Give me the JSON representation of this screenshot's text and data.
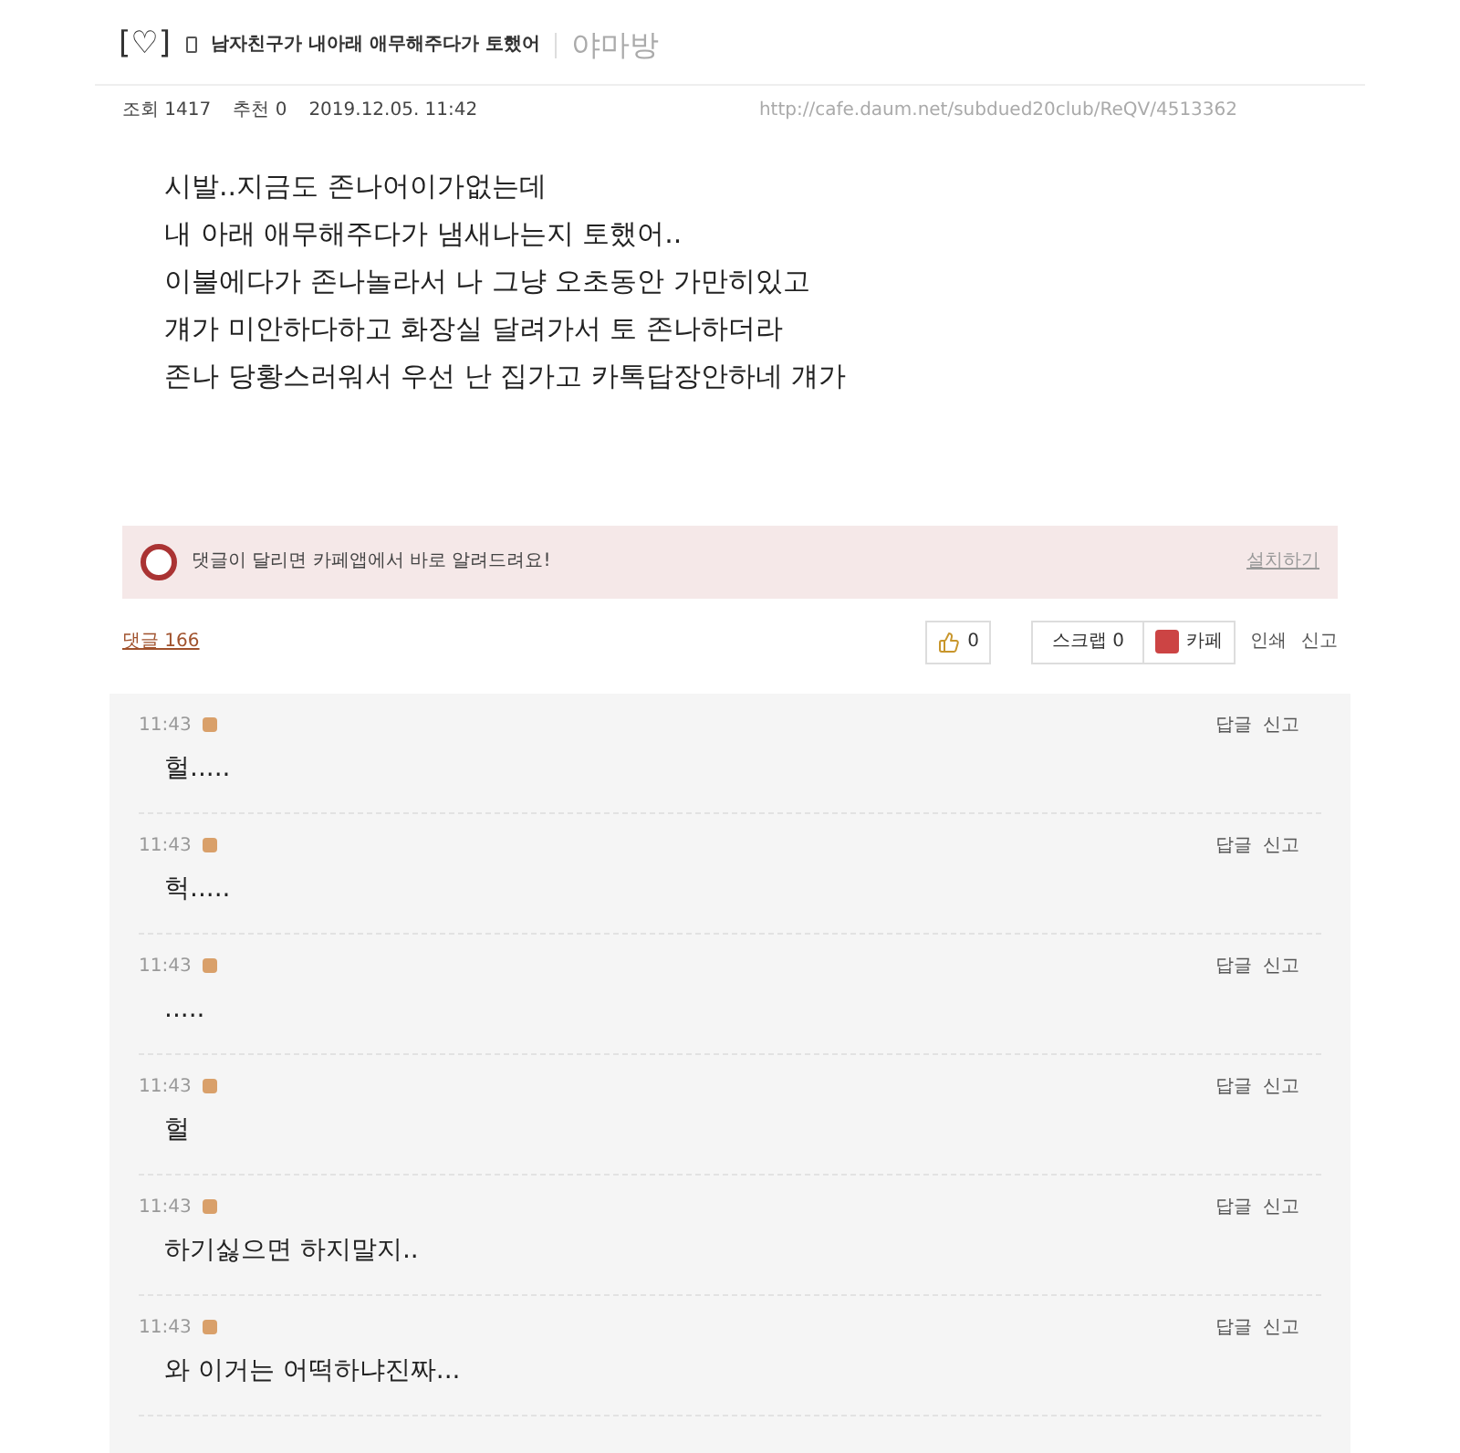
{
  "header": {
    "bracket": "[♡]",
    "title": "남자친구가 내아래 애무해주다가 토했어",
    "board": "야마방"
  },
  "meta": {
    "views": "조회 1417",
    "recommends": "추천 0",
    "date": "2019.12.05. 11:42",
    "url": "http://cafe.daum.net/subdued20club/ReQV/4513362"
  },
  "body": [
    "시발..지금도 존나어이가없는데",
    "내 아래 애무해주다가 냄새나는지 토했어..",
    "이불에다가 존나놀라서 나 그냥 오초동안 가만히있고",
    "걔가 미안하다하고 화장실 달려가서 토 존나하더라",
    "존나 당황스러워서 우선 난 집가고 카톡답장안하네 걔가"
  ],
  "notice": {
    "text": "댓글이 달리면 카페앱에서 바로 알려드려요!",
    "link": "설치하기"
  },
  "actions": {
    "comments_count": "댓글 166",
    "likes": "0",
    "scrap": "스크랩 0",
    "cafe": "카페",
    "print": "인쇄",
    "report": "신고"
  },
  "comments": [
    {
      "time": "11:43",
      "text": "헐.....",
      "reply": "답글",
      "report": "신고"
    },
    {
      "time": "11:43",
      "text": "헉.....",
      "reply": "답글",
      "report": "신고"
    },
    {
      "time": "11:43",
      "text": ".....",
      "reply": "답글",
      "report": "신고"
    },
    {
      "time": "11:43",
      "text": "헐",
      "reply": "답글",
      "report": "신고"
    },
    {
      "time": "11:43",
      "text": "하기싫으면 하지말지..",
      "reply": "답글",
      "report": "신고"
    },
    {
      "time": "11:43",
      "text": "와 이거는 어떡하냐진짜...",
      "reply": "답글",
      "report": "신고"
    }
  ]
}
